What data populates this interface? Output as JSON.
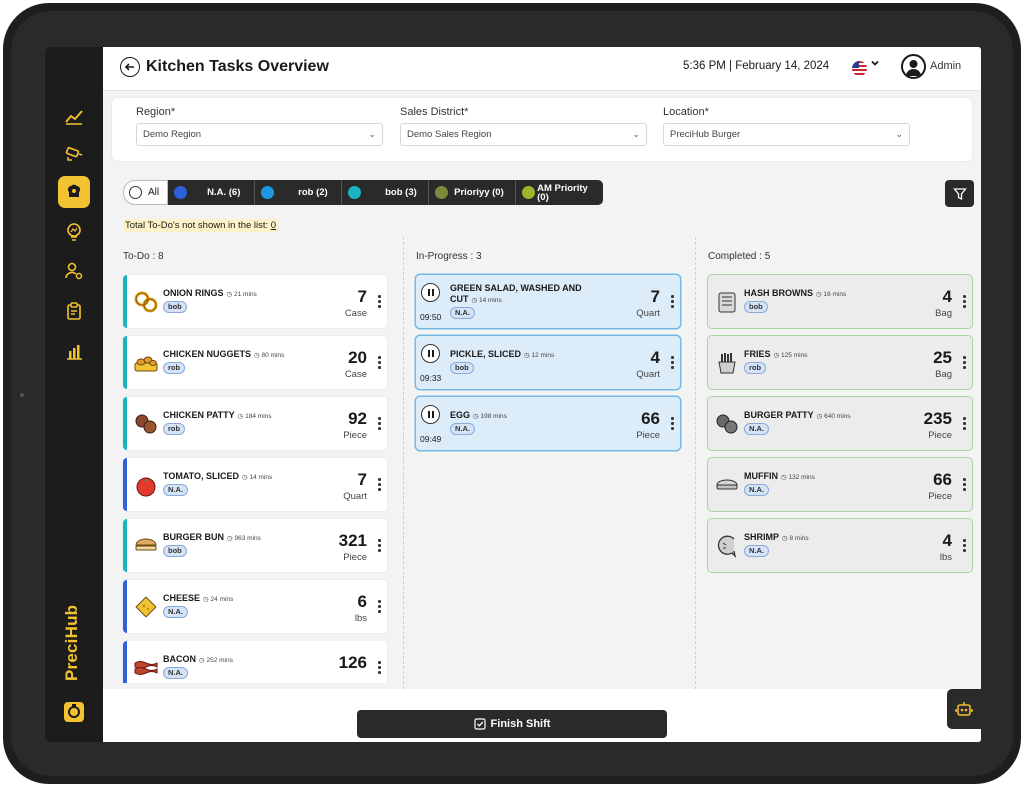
{
  "header": {
    "title": "Kitchen Tasks Overview",
    "datetime": "5:36 PM | February 14, 2024",
    "user": "Admin"
  },
  "filters": {
    "region": {
      "label": "Region*",
      "value": "Demo Region"
    },
    "sales_district": {
      "label": "Sales District*",
      "value": "Demo Sales Region"
    },
    "location": {
      "label": "Location*",
      "value": "PreciHub Burger"
    }
  },
  "pills": {
    "all": "All",
    "items": [
      {
        "label": "N.A. (6)",
        "color": "#2f61d8"
      },
      {
        "label": "rob (2)",
        "color": "#1e97e2"
      },
      {
        "label": "bob (3)",
        "color": "#1ab3c3"
      },
      {
        "label": "Prioriyy (0)",
        "color": "#7e8a3a"
      },
      {
        "label": "AM Priority (0)",
        "color": "#9fb42a"
      }
    ]
  },
  "hidden_note": {
    "text": "Total To-Do's not shown in the list: ",
    "count": "0"
  },
  "columns": {
    "todo": {
      "title": "To-Do : 8",
      "cards": [
        {
          "name": "ONION RINGS",
          "mins": "21 mins",
          "tag": "bob",
          "qty": "7",
          "unit": "Case",
          "icon": "onion-rings-icon"
        },
        {
          "name": "CHICKEN NUGGETS",
          "mins": "80 mins",
          "tag": "rob",
          "qty": "20",
          "unit": "Case",
          "icon": "chicken-nuggets-icon"
        },
        {
          "name": "CHICKEN PATTY",
          "mins": "184 mins",
          "tag": "rob",
          "qty": "92",
          "unit": "Piece",
          "icon": "chicken-patty-icon"
        },
        {
          "name": "TOMATO, SLICED",
          "mins": "14 mins",
          "tag": "N.A.",
          "qty": "7",
          "unit": "Quart",
          "icon": "tomato-icon"
        },
        {
          "name": "BURGER BUN",
          "mins": "963 mins",
          "tag": "bob",
          "qty": "321",
          "unit": "Piece",
          "icon": "burger-bun-icon"
        },
        {
          "name": "CHEESE",
          "mins": "24 mins",
          "tag": "N.A.",
          "qty": "6",
          "unit": "lbs",
          "icon": "cheese-icon"
        },
        {
          "name": "BACON",
          "mins": "252 mins",
          "tag": "N.A.",
          "qty": "126",
          "unit": "",
          "icon": "bacon-icon"
        }
      ]
    },
    "in_progress": {
      "title": "In-Progress : 3",
      "cards": [
        {
          "name": "GREEN SALAD, WASHED AND CUT",
          "mins": "14 mins",
          "tag": "N.A.",
          "qty": "7",
          "unit": "Quart",
          "timer": "09:50"
        },
        {
          "name": "PICKLE, SLICED",
          "mins": "12 mins",
          "tag": "bob",
          "qty": "4",
          "unit": "Quart",
          "timer": "09:33"
        },
        {
          "name": "EGG",
          "mins": "198 mins",
          "tag": "N.A.",
          "qty": "66",
          "unit": "Piece",
          "timer": "09:49"
        }
      ]
    },
    "completed": {
      "title": "Completed : 5",
      "cards": [
        {
          "name": "HASH BROWNS",
          "mins": "16 mins",
          "tag": "bob",
          "qty": "4",
          "unit": "Bag",
          "icon": "hash-browns-icon"
        },
        {
          "name": "FRIES",
          "mins": "125 mins",
          "tag": "rob",
          "qty": "25",
          "unit": "Bag",
          "icon": "fries-icon"
        },
        {
          "name": "BURGER PATTY",
          "mins": "640 mins",
          "tag": "N.A.",
          "qty": "235",
          "unit": "Piece",
          "icon": "burger-patty-icon"
        },
        {
          "name": "MUFFIN",
          "mins": "132 mins",
          "tag": "N.A.",
          "qty": "66",
          "unit": "Piece",
          "icon": "muffin-icon"
        },
        {
          "name": "SHRIMP",
          "mins": "8 mins",
          "tag": "N.A.",
          "qty": "4",
          "unit": "lbs",
          "icon": "shrimp-icon"
        }
      ]
    }
  },
  "footer": {
    "finish_label": "Finish Shift"
  },
  "brand": {
    "name": "PreciHub",
    "accent": "#f2c230"
  }
}
